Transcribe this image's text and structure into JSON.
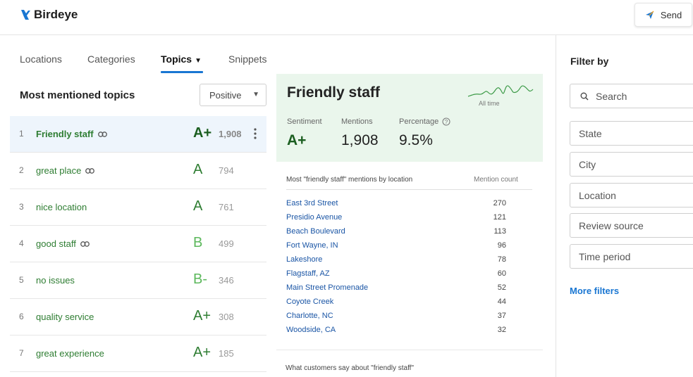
{
  "brand": {
    "name": "Birdeye",
    "color": "#1976d2"
  },
  "header": {
    "send_label": "Send"
  },
  "tabs": [
    {
      "label": "Locations"
    },
    {
      "label": "Categories"
    },
    {
      "label": "Topics",
      "active": true
    },
    {
      "label": "Snippets"
    }
  ],
  "left": {
    "title": "Most mentioned topics",
    "sentiment_select": "Positive",
    "topics": [
      {
        "rank": "1",
        "name": "Friendly staff",
        "grade": "A+",
        "count": "1,908",
        "linked": true,
        "selected": true
      },
      {
        "rank": "2",
        "name": "great place",
        "grade": "A",
        "count": "794",
        "linked": true
      },
      {
        "rank": "3",
        "name": "nice location",
        "grade": "A",
        "count": "761",
        "linked": false
      },
      {
        "rank": "4",
        "name": "good staff",
        "grade": "B",
        "count": "499",
        "linked": true
      },
      {
        "rank": "5",
        "name": "no issues",
        "grade": "B-",
        "count": "346",
        "linked": false
      },
      {
        "rank": "6",
        "name": "quality service",
        "grade": "A+",
        "count": "308",
        "linked": false
      },
      {
        "rank": "7",
        "name": "great experience",
        "grade": "A+",
        "count": "185",
        "linked": false
      }
    ]
  },
  "detail": {
    "title": "Friendly staff",
    "sparkline_label": "All time",
    "sentiment_label": "Sentiment",
    "sentiment_value": "A+",
    "mentions_label": "Mentions",
    "mentions_value": "1,908",
    "percentage_label": "Percentage",
    "percentage_value": "9.5%",
    "locations_heading": "Most \"friendly staff\" mentions by location",
    "mention_count_heading": "Mention count",
    "locations": [
      {
        "name": "East 3rd Street",
        "count": "270"
      },
      {
        "name": "Presidio Avenue",
        "count": "121"
      },
      {
        "name": "Beach Boulevard",
        "count": "113"
      },
      {
        "name": "Fort Wayne, IN",
        "count": "96"
      },
      {
        "name": "Lakeshore",
        "count": "78"
      },
      {
        "name": "Flagstaff, AZ",
        "count": "60"
      },
      {
        "name": "Main Street Promenade",
        "count": "52"
      },
      {
        "name": "Coyote Creek",
        "count": "44"
      },
      {
        "name": "Charlotte, NC",
        "count": "37"
      },
      {
        "name": "Woodside, CA",
        "count": "32"
      }
    ],
    "customers_say": "What customers say about \"friendly staff\""
  },
  "filters": {
    "title": "Filter by",
    "search_placeholder": "Search",
    "fields": [
      "State",
      "City",
      "Location",
      "Review source",
      "Time period"
    ],
    "more_filters": "More filters"
  },
  "colors": {
    "accent": "#1976d2",
    "positive_green": "#2e7d32",
    "panel_green": "#eaf6ec",
    "link_blue": "#1a55a5"
  }
}
